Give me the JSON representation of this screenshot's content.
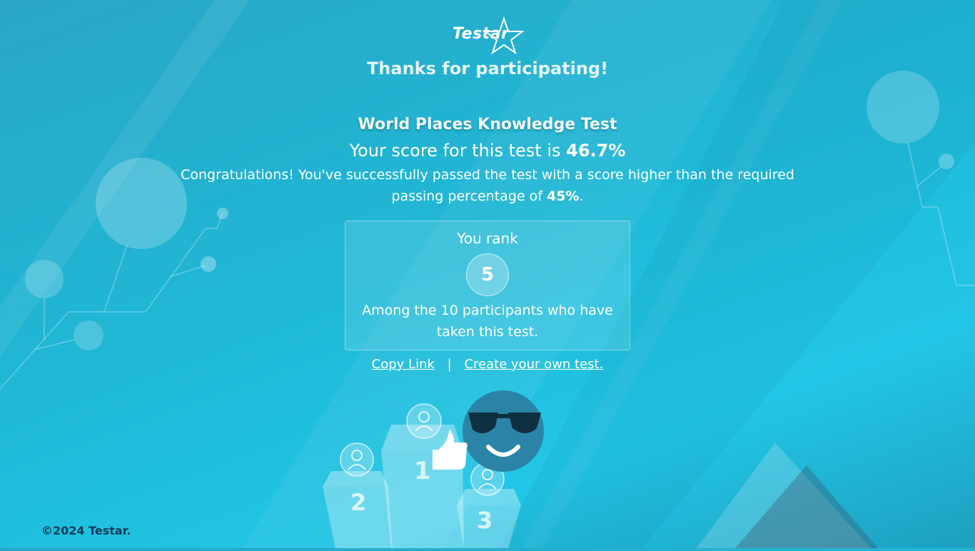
{
  "brand": {
    "logo_text": "Testar",
    "logo_icon": "star-outline-icon"
  },
  "header": {
    "thanks": "Thanks for participating!"
  },
  "result": {
    "test_title": "World Places Knowledge Test",
    "score_prefix": "Your score for this test is",
    "score_value": "46.7%",
    "congrats_text": "Congratulations! You've successfully passed the test with a score higher than the required passing percentage of",
    "passing_value": "45%",
    "congrats_end": "."
  },
  "rank": {
    "label": "You rank",
    "value": "5",
    "description": "Among the 10 participants who have taken this test."
  },
  "links": {
    "copy_link": "Copy Link",
    "separator": "|",
    "create_test": "Create your own test."
  },
  "podium": {
    "place_1": "1",
    "place_2": "2",
    "place_3": "3",
    "emoji_icon": "sunglasses-smiley-icon",
    "thumb_icon": "thumbs-up-icon",
    "avatar_icon": "user-avatar-icon"
  },
  "footer": {
    "copyright": "©2024 Testar."
  },
  "colors": {
    "bg_top": "#2aa6c6",
    "bg_bottom": "#22c6e6",
    "footer_text": "#0d3d57"
  }
}
